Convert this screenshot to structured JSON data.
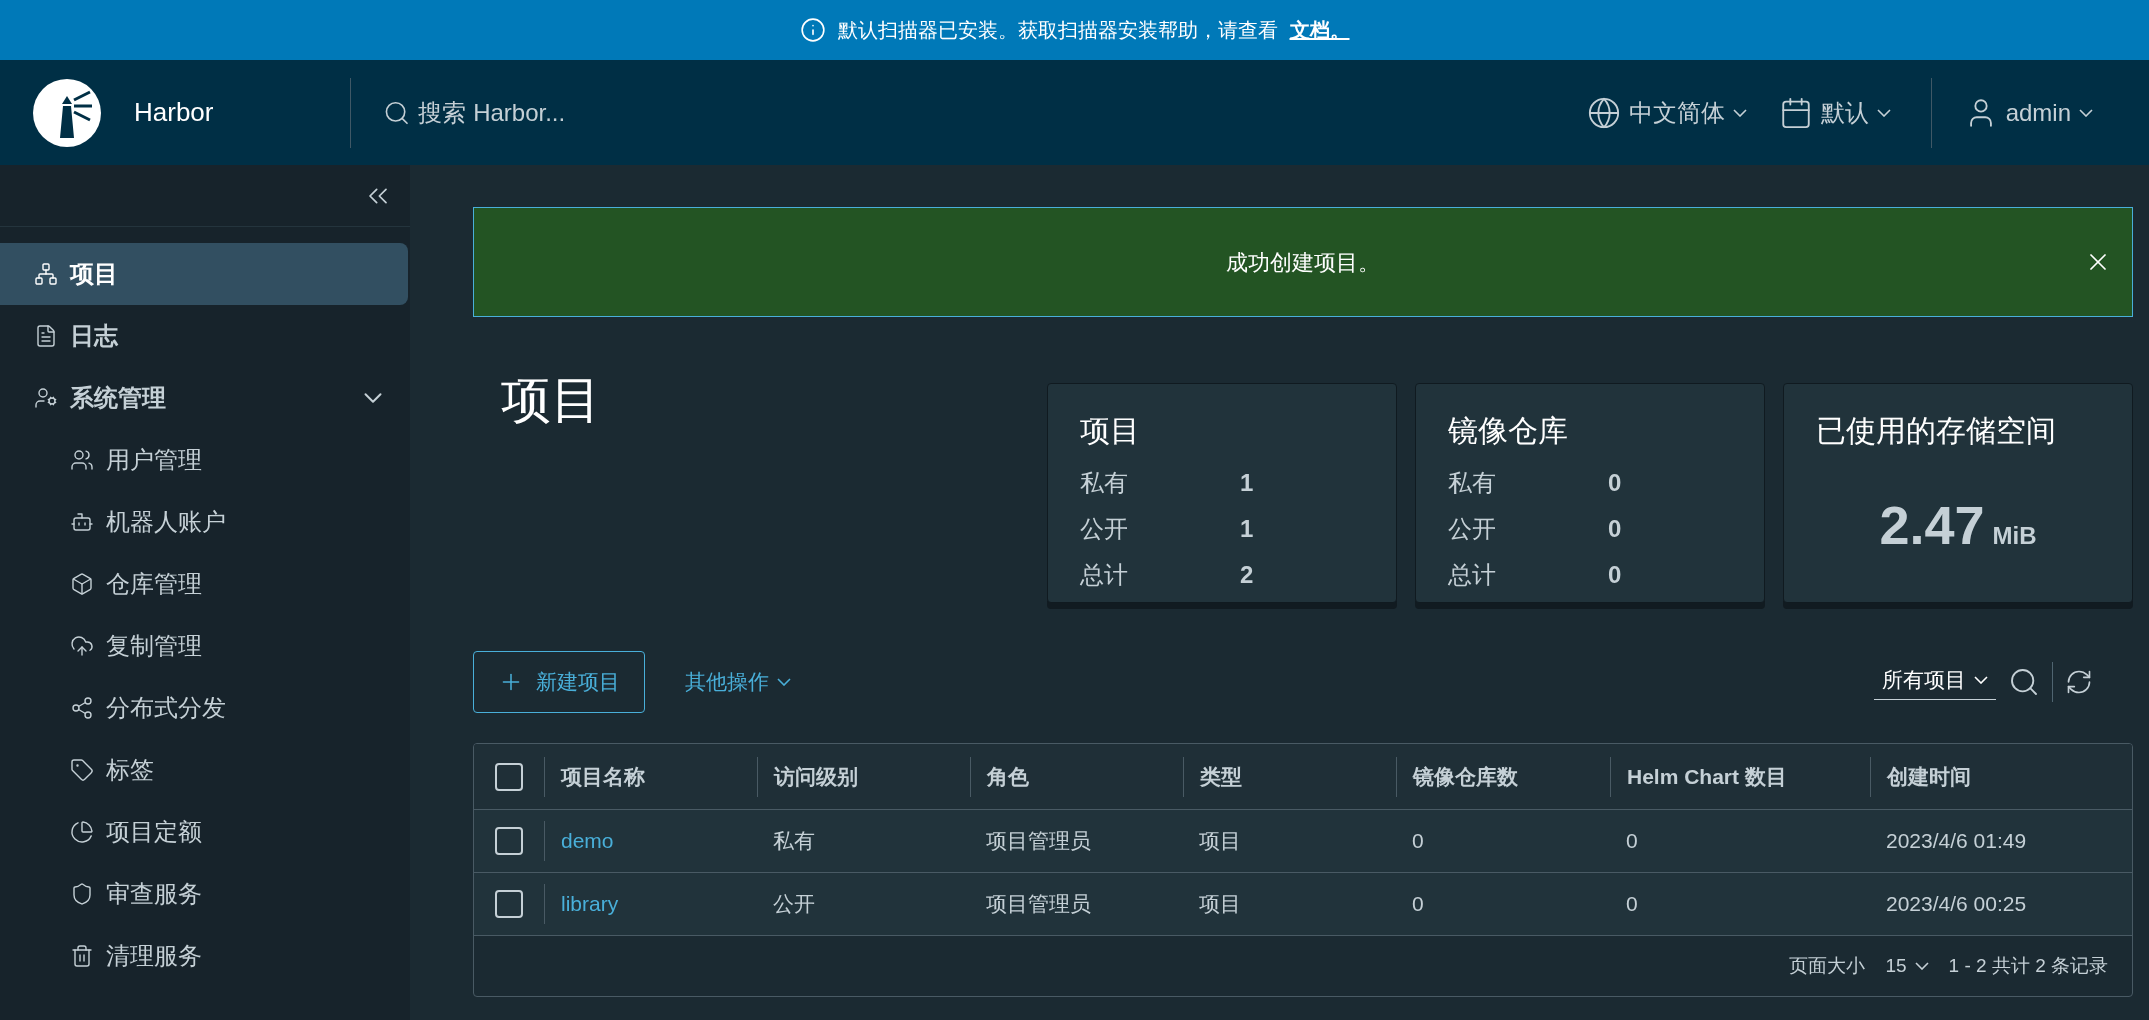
{
  "banner": {
    "message": "默认扫描器已安装。获取扫描器安装帮助，请查看",
    "link": "文档。"
  },
  "header": {
    "brand": "Harbor",
    "search_placeholder": "搜索 Harbor...",
    "language": "中文简体",
    "theme": "默认",
    "user": "admin"
  },
  "sidebar": {
    "items": [
      {
        "label": "项目",
        "selected": true
      },
      {
        "label": "日志",
        "selected": false
      },
      {
        "label": "系统管理",
        "selected": false,
        "expanded": true,
        "children": [
          {
            "label": "用户管理",
            "selected": false
          },
          {
            "label": "机器人账户",
            "selected": false
          },
          {
            "label": "仓库管理",
            "selected": false
          },
          {
            "label": "复制管理",
            "selected": false
          },
          {
            "label": "分布式分发",
            "selected": false
          },
          {
            "label": "标签",
            "selected": false
          },
          {
            "label": "项目定额",
            "selected": false
          },
          {
            "label": "审查服务",
            "selected": false
          },
          {
            "label": "清理服务",
            "selected": false
          }
        ]
      }
    ]
  },
  "alert": {
    "message": "成功创建项目。"
  },
  "page_title": "项目",
  "cards": [
    {
      "kind": "counts",
      "title": "项目",
      "rows": [
        {
          "label": "私有",
          "value": "1"
        },
        {
          "label": "公开",
          "value": "1"
        },
        {
          "label": "总计",
          "value": "2"
        }
      ]
    },
    {
      "kind": "counts",
      "title": "镜像仓库",
      "rows": [
        {
          "label": "私有",
          "value": "0"
        },
        {
          "label": "公开",
          "value": "0"
        },
        {
          "label": "总计",
          "value": "0"
        }
      ]
    },
    {
      "kind": "storage",
      "title": "已使用的存储空间",
      "value": "2.47",
      "unit": "MiB"
    }
  ],
  "toolbar": {
    "new_button": "新建项目",
    "more_actions": "其他操作",
    "filter": "所有项目"
  },
  "table": {
    "select_all": {
      "checked": false
    },
    "columns": [
      "项目名称",
      "访问级别",
      "角色",
      "类型",
      "镜像仓库数",
      "Helm Chart 数目",
      "创建时间"
    ],
    "rows": [
      {
        "checked": false,
        "cells": [
          "demo",
          "私有",
          "项目管理员",
          "项目",
          "0",
          "0",
          "2023/4/6 01:49"
        ]
      },
      {
        "checked": false,
        "cells": [
          "library",
          "公开",
          "项目管理员",
          "项目",
          "0",
          "0",
          "2023/4/6 00:25"
        ]
      }
    ],
    "footer": {
      "page_size_label": "页面大小",
      "page_size": "15",
      "summary": "1 - 2 共计 2 条记录"
    }
  }
}
